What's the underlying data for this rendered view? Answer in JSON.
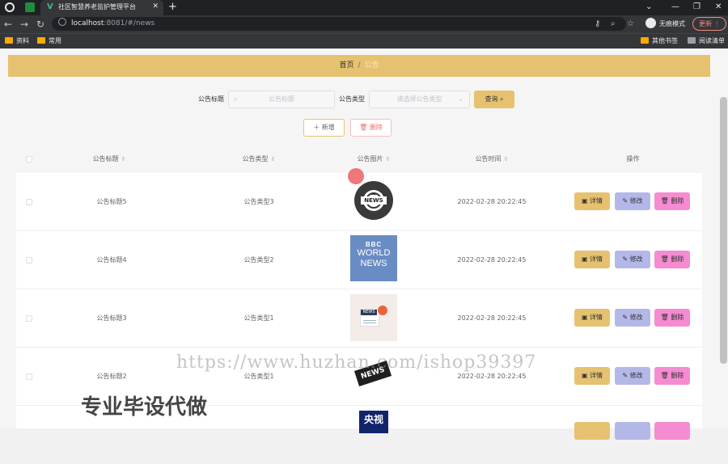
{
  "browser": {
    "tab_title": "社区智慧养老监护管理平台",
    "new_tab": "+",
    "url_host": "localhost",
    "url_path": ":8081/#/news",
    "incognito": "无痕模式",
    "update": "更新",
    "bookmarks": [
      "资料",
      "常用"
    ],
    "bookmarks_right": [
      "其他书签",
      "阅读清单"
    ]
  },
  "breadcrumb": {
    "home": "首页",
    "sep": "/",
    "current": "公告"
  },
  "search": {
    "title_label": "公告标题",
    "title_placeholder": "公告标题",
    "type_label": "公告类型",
    "type_placeholder": "请选择公告类型",
    "query_button": "查询"
  },
  "toolbar": {
    "add_label": "新增",
    "delete_label": "删除"
  },
  "table": {
    "columns": [
      "公告标题",
      "公告类型",
      "公告图片",
      "公告时间",
      "操作"
    ],
    "rows": [
      {
        "title": "公告标题5",
        "type": "公告类型3",
        "time": "2022-02-28 20:22:45",
        "image": "news-globe-icon"
      },
      {
        "title": "公告标题4",
        "type": "公告类型2",
        "time": "2022-02-28 20:22:45",
        "image": "bbc-world-news"
      },
      {
        "title": "公告标题3",
        "type": "公告类型1",
        "time": "2022-02-28 20:22:45",
        "image": "news-megaphone"
      },
      {
        "title": "公告标题2",
        "type": "公告类型1",
        "time": "2022-02-28 20:22:45",
        "image": "news-tag"
      },
      {
        "title": "",
        "type": "",
        "time": "",
        "image": "cctv-logo"
      }
    ],
    "actions": {
      "detail": "详情",
      "edit": "修改",
      "delete": "删除"
    }
  },
  "watermark": {
    "url": "https://www.huzhan.com/ishop39397",
    "text": "专业毕设代做"
  },
  "images": {
    "bbc_logo": "BBC",
    "bbc_world": "WORLD",
    "bbc_news": "NEWS",
    "news_globe": "NEWS",
    "news_mega": "NEWS",
    "news_tag": "NEWS",
    "cctv": "央视"
  },
  "colors": {
    "accent": "#e6c270",
    "edit": "#b4b8e8",
    "delete": "#f58bd0"
  }
}
